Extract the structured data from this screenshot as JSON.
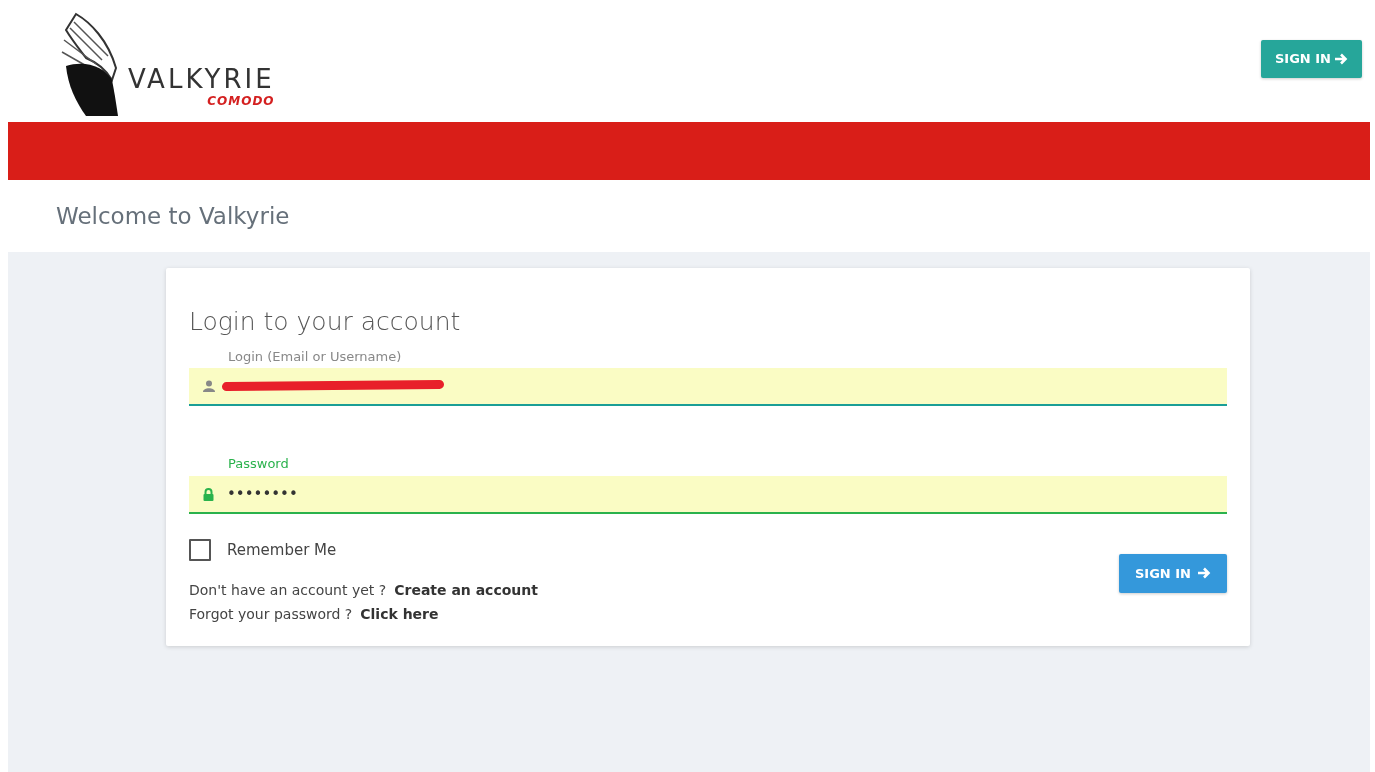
{
  "header": {
    "logo": {
      "name": "VALKYRIE",
      "sub": "COMODO"
    },
    "button": "SIGN IN"
  },
  "welcome": "Welcome to Valkyrie",
  "form": {
    "title": "Login to your account",
    "fields": [
      {
        "kind": "text",
        "label": "Login (Email or Username)",
        "redacted": true,
        "focused": false
      },
      {
        "kind": "password",
        "label": "Password",
        "value": "••••••••",
        "redacted": false,
        "focused": true
      }
    ],
    "remember": {
      "label": "Remember Me",
      "checked": false
    },
    "submit": "SIGN IN",
    "links": [
      {
        "text": "Don't have an account yet ?",
        "link": "Create an account"
      },
      {
        "text": "Forgot your password ?",
        "link": "Click here"
      }
    ]
  }
}
